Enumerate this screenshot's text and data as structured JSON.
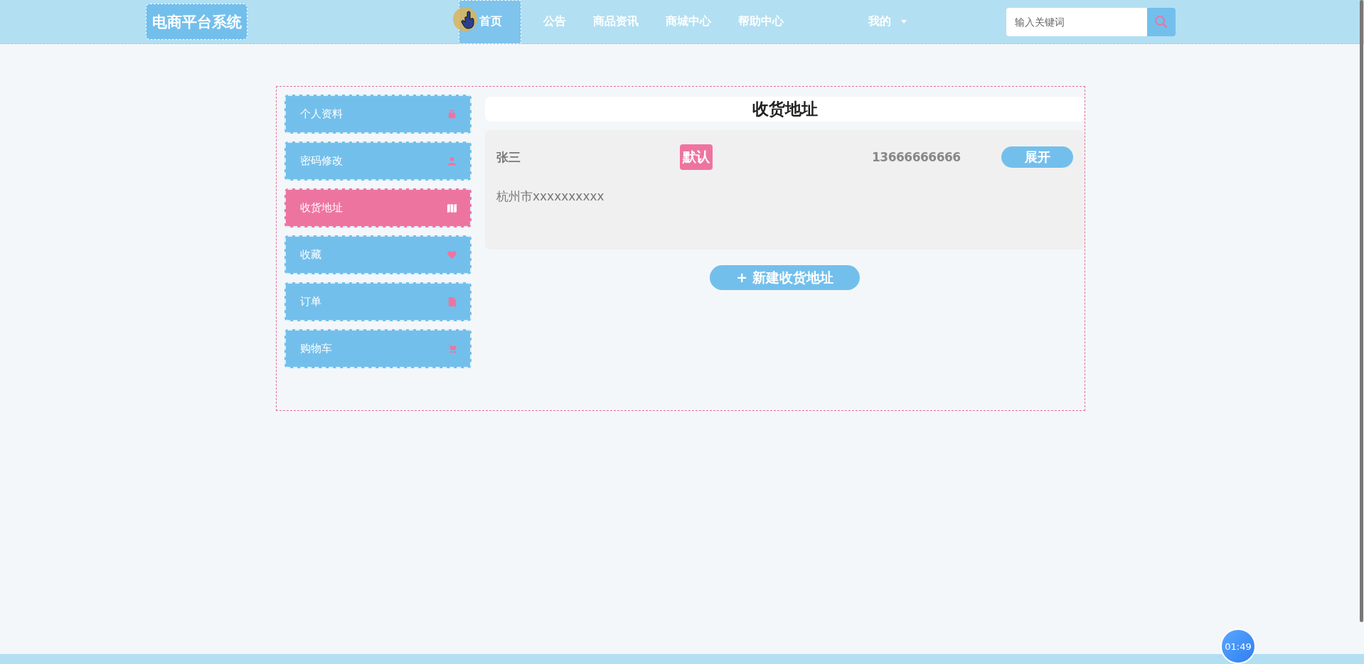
{
  "header": {
    "logo": "电商平台系统",
    "nav": [
      {
        "label": "首页",
        "selected": true
      },
      {
        "label": "公告",
        "selected": false
      },
      {
        "label": "商品资讯",
        "selected": false
      },
      {
        "label": "商城中心",
        "selected": false
      },
      {
        "label": "帮助中心",
        "selected": false
      }
    ],
    "user_menu": "我的",
    "search": {
      "placeholder": "输入关键词"
    }
  },
  "sidebar": {
    "items": [
      {
        "label": "个人资料",
        "selected": false
      },
      {
        "label": "密码修改",
        "selected": false
      },
      {
        "label": "收货地址",
        "selected": true
      },
      {
        "label": "收藏",
        "selected": false
      },
      {
        "label": "订单",
        "selected": false
      },
      {
        "label": "购物车",
        "selected": false
      }
    ]
  },
  "content": {
    "title": "收货地址",
    "addresses": [
      {
        "name": "张三",
        "tag": "默认",
        "phone": "13666666666",
        "toggle": "展开",
        "address": "杭州市xxxxxxxxxx"
      }
    ],
    "new_button": "+ 新建收货地址"
  },
  "timer": "01:49"
}
